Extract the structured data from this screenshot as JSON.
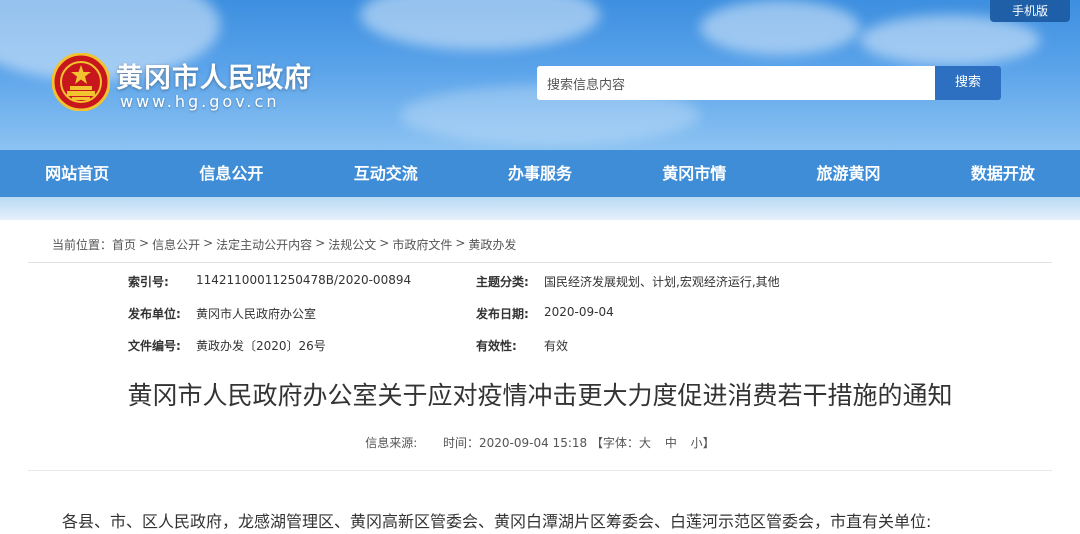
{
  "header": {
    "mobile_link": "手机版",
    "site_title": "黄冈市人民政府",
    "site_url": "www.hg.gov.cn",
    "search_placeholder": "搜索信息内容",
    "search_button": "搜索"
  },
  "nav": {
    "items": [
      "网站首页",
      "信息公开",
      "互动交流",
      "办事服务",
      "黄冈市情",
      "旅游黄冈",
      "数据开放"
    ]
  },
  "breadcrumb": {
    "prefix": "当前位置：",
    "items": [
      "首页",
      "信息公开",
      "法定主动公开内容",
      "法规公文",
      "市政府文件",
      "黄政办发"
    ]
  },
  "meta": {
    "index_label": "索引号:",
    "index_value": "11421100011250478B/2020-00894",
    "topic_label": "主题分类:",
    "topic_value": "国民经济发展规划、计划,宏观经济运行,其他",
    "publisher_label": "发布单位:",
    "publisher_value": "黄冈市人民政府办公室",
    "date_label": "发布日期:",
    "date_value": "2020-09-04",
    "docno_label": "文件编号:",
    "docno_value": "黄政办发〔2020〕26号",
    "validity_label": "有效性:",
    "validity_value": "有效"
  },
  "article": {
    "title": "黄冈市人民政府办公室关于应对疫情冲击更大力度促进消费若干措施的通知",
    "source_label": "信息来源:",
    "time_label": "时间：",
    "time_value": "2020-09-04 15:18",
    "font_label": "【字体：",
    "font_large": "大",
    "font_medium": "中",
    "font_small": "小",
    "font_close": "】",
    "salutation": "各县、市、区人民政府，龙感湖管理区、黄冈高新区管委会、黄冈白潭湖片区筹委会、白莲河示范区管委会，市直有关单位:"
  }
}
